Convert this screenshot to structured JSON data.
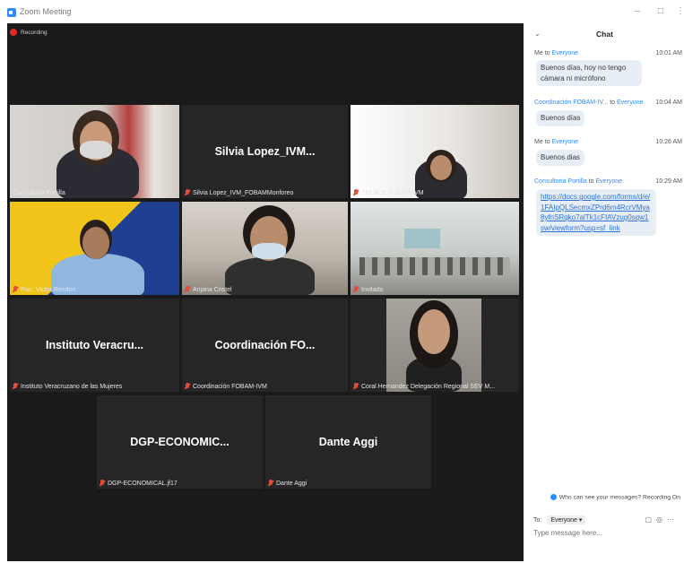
{
  "window": {
    "title": "Zoom Meeting"
  },
  "recording": {
    "label": "Recording"
  },
  "tiles": {
    "portilla": {
      "name": "Consultoria Portilla"
    },
    "silvia": {
      "display": "Silvia Lopez_IVM...",
      "name": "Silvia Lopez_IVM_FOBAMMonforeo"
    },
    "enlace": {
      "name": "ENLACE FOBAM-IVM"
    },
    "rendon": {
      "name": "Psic. Victor Rendón"
    },
    "cristel": {
      "name": "Anjana Cristel"
    },
    "invitado": {
      "name": "Invitado"
    },
    "instituto": {
      "display": "Instituto Veracru...",
      "name": "Instituto Veracruzano de las Mujeres"
    },
    "coordinacion": {
      "display": "Coordinación FO...",
      "name": "Coordinación FOBAM-IVM"
    },
    "coral": {
      "name": "Coral Hernandez Delegación Regional SEV M..."
    },
    "dgp": {
      "display": "DGP-ECONOMIC...",
      "name": "DGP-ECONOMICAL.jf17"
    },
    "dante": {
      "display": "Dante Aggi",
      "name": "Dante Aggi"
    }
  },
  "chat": {
    "title": "Chat",
    "messages": [
      {
        "from": "Me",
        "to_word": "to",
        "to": "Everyone",
        "time": "10:01 AM",
        "text": "Buenos días, hoy no tengo cámara ni micrófono"
      },
      {
        "from": "Coordinación FOBAM-IV...",
        "to_word": "to",
        "to": "Everyone",
        "time": "10:04 AM",
        "text": "Buenos días"
      },
      {
        "from": "Me",
        "to_word": "to",
        "to": "Everyone",
        "time": "10:26 AM",
        "text": "Buenos dias"
      },
      {
        "from": "Consultoria Portilla",
        "to_word": "to",
        "to": "Everyone",
        "time": "10:29 AM",
        "text": "https://docs.google.com/forms/d/e/1FAIpQLSecmxZPrd6m4RcrVMya8yfnSRqko7alTk1cFIAVzug0sqw1sw/viewform?usp=sf_link"
      }
    ],
    "privacy_text": "Who can see your messages? Recording On",
    "to_label": "To:",
    "to_value": "Everyone",
    "input_placeholder": "Type message here..."
  }
}
